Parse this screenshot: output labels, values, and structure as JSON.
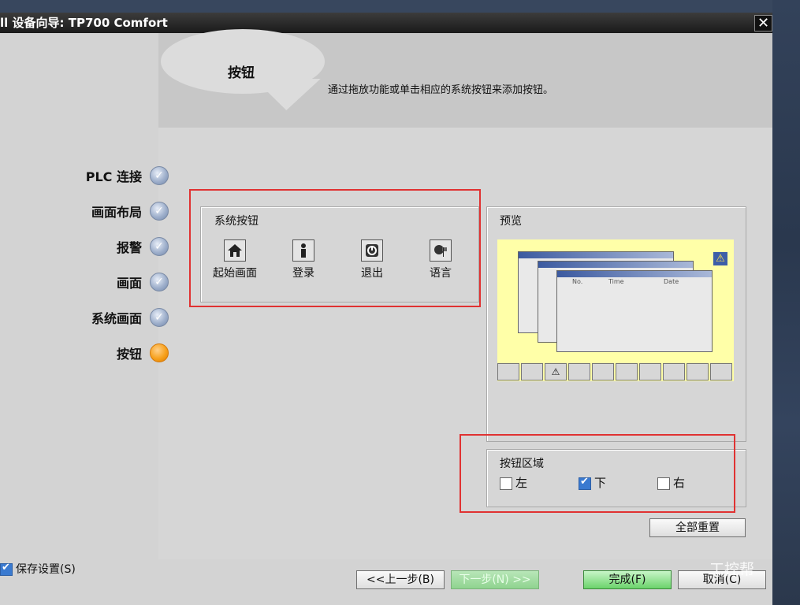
{
  "window": {
    "title": "ll 设备向导: TP700 Comfort",
    "close_glyph": "✕"
  },
  "header": {
    "title": "按钮",
    "description": "通过拖放功能或单击相应的系统按钮来添加按钮。"
  },
  "steps": [
    {
      "label": "PLC 连接",
      "status": "done"
    },
    {
      "label": "画面布局",
      "status": "done"
    },
    {
      "label": "报警",
      "status": "done"
    },
    {
      "label": "画面",
      "status": "done"
    },
    {
      "label": "系统画面",
      "status": "done"
    },
    {
      "label": "按钮",
      "status": "current"
    }
  ],
  "system_buttons": {
    "title": "系统按钮",
    "items": [
      {
        "label": "起始画面",
        "icon": "home-icon"
      },
      {
        "label": "登录",
        "icon": "user-icon"
      },
      {
        "label": "退出",
        "icon": "power-icon"
      },
      {
        "label": "语言",
        "icon": "language-icon"
      }
    ]
  },
  "preview": {
    "title": "预览",
    "table_headers": [
      "No.",
      "Time",
      "Date"
    ]
  },
  "button_area": {
    "title": "按钮区域",
    "options": [
      {
        "label": "左",
        "checked": false
      },
      {
        "label": "下",
        "checked": true
      },
      {
        "label": "右",
        "checked": false
      }
    ]
  },
  "reset_all_label": "全部重置",
  "footer": {
    "save_settings_label": "保存设置(S)",
    "save_settings_checked": true,
    "back_label": "<<上一步(B)",
    "next_label": "下一步(N) >>",
    "finish_label": "完成(F)",
    "cancel_label": "取消(C)",
    "watermark": "工控帮"
  },
  "colors": {
    "highlight_red": "#e03232",
    "current_step": "#f7a11c",
    "preview_bg": "#ffffa8"
  }
}
